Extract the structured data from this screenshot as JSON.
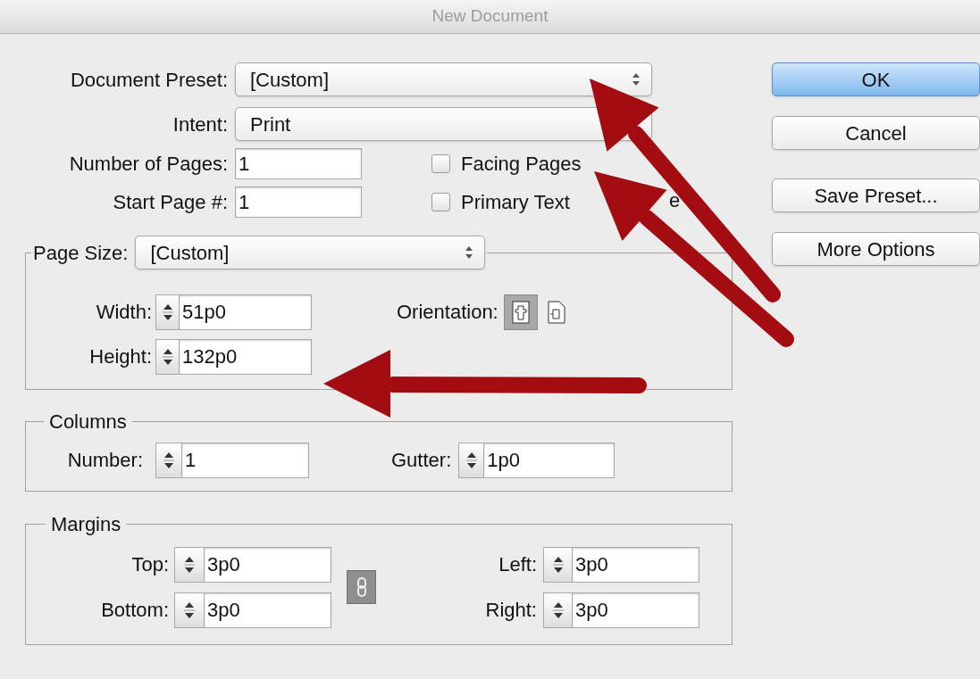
{
  "window": {
    "title": "New Document"
  },
  "document_preset": {
    "label": "Document Preset:",
    "value": "[Custom]",
    "indicator_visible": true
  },
  "intent": {
    "label": "Intent:",
    "value": "Print",
    "indicator_visible": false
  },
  "number_of_pages": {
    "label": "Number of Pages:",
    "value": "1"
  },
  "start_page": {
    "label": "Start Page #:",
    "value": "1"
  },
  "checkboxes": [
    {
      "label": "Facing Pages",
      "checked": false
    },
    {
      "label": "Primary Text",
      "label_tail": "e",
      "checked": false
    }
  ],
  "page_size": {
    "label": "Page Size:",
    "value": "[Custom]",
    "indicator_visible": true,
    "width": {
      "label": "Width:",
      "value": "51p0"
    },
    "height": {
      "label": "Height:",
      "value": "132p0"
    },
    "orientation": {
      "label": "Orientation:",
      "options": [
        {
          "kind": "portrait",
          "selected": true
        },
        {
          "kind": "landscape",
          "selected": false
        }
      ]
    }
  },
  "columns": {
    "title": "Columns",
    "number": {
      "label": "Number:",
      "value": "1"
    },
    "gutter": {
      "label": "Gutter:",
      "value": "1p0"
    }
  },
  "margins": {
    "title": "Margins",
    "top": {
      "label": "Top:",
      "value": "3p0"
    },
    "bottom": {
      "label": "Bottom:",
      "value": "3p0"
    },
    "left": {
      "label": "Left:",
      "value": "3p0"
    },
    "right": {
      "label": "Right:",
      "value": "3p0"
    }
  },
  "buttons": [
    {
      "label": "OK",
      "kind": "default"
    },
    {
      "label": "Cancel",
      "kind": "normal"
    },
    {
      "label": "Save Preset...",
      "kind": "normal"
    },
    {
      "label": "More Options",
      "kind": "normal"
    }
  ]
}
